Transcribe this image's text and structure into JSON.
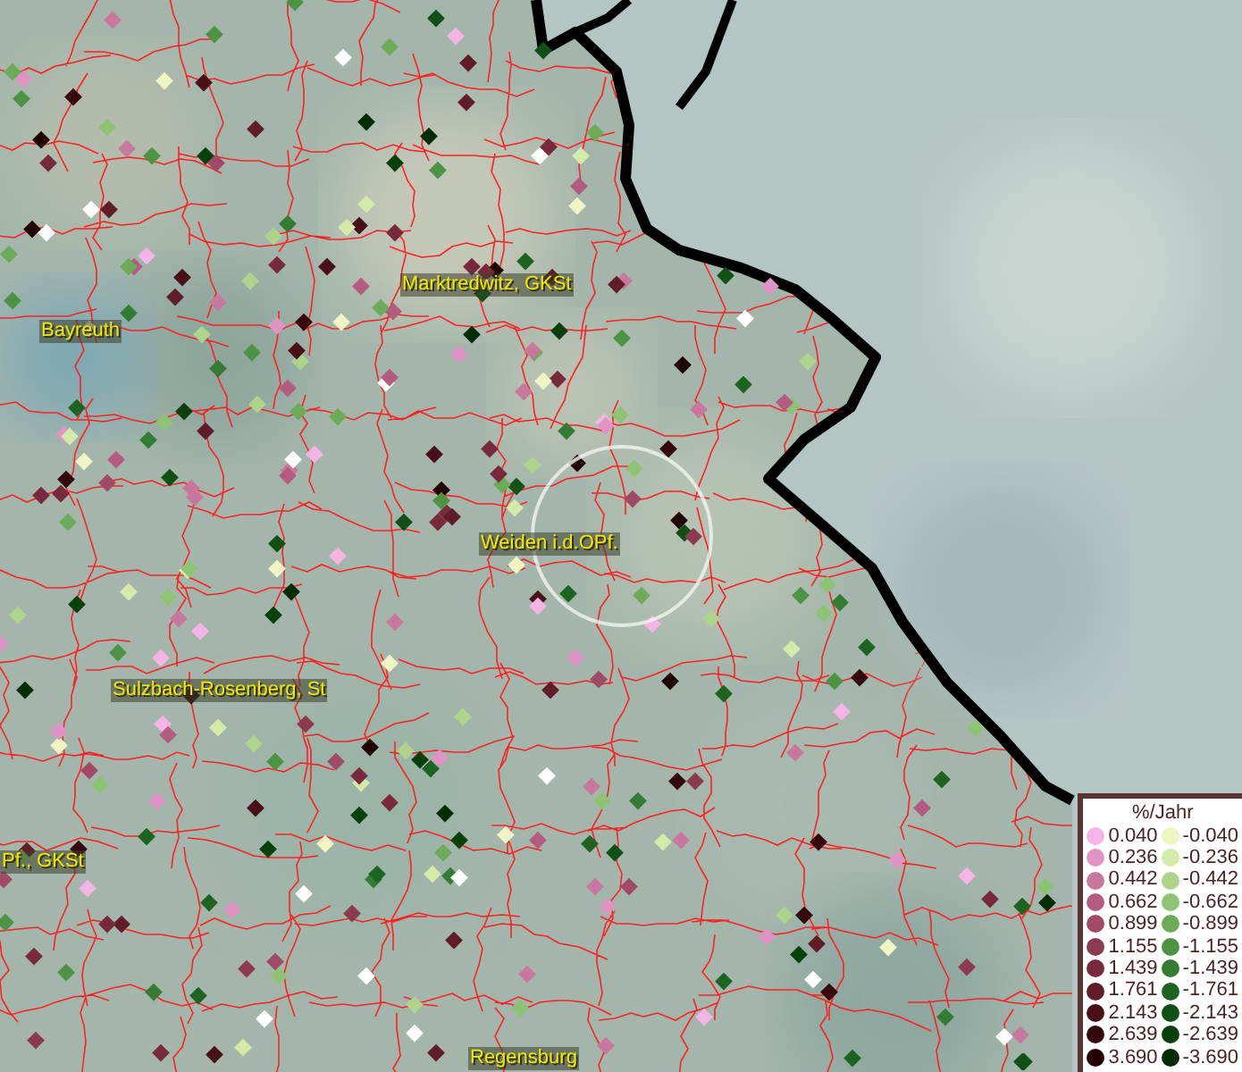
{
  "map": {
    "places": [
      {
        "name": "Marktredwitz, GKSt"
      },
      {
        "name": "Bayreuth"
      },
      {
        "name": "Weiden i.d.OPf."
      },
      {
        "name": "Sulzbach-Rosenberg, St"
      },
      {
        "name": "Pf., GKSt"
      },
      {
        "name": "Regensburg"
      }
    ]
  },
  "legend": {
    "title": "%/Jahr",
    "rows": [
      {
        "positive": {
          "value": "0.040",
          "color": "#f4b4e4"
        },
        "negative": {
          "value": "-0.040",
          "color": "#f0f5c4"
        }
      },
      {
        "positive": {
          "value": "0.236",
          "color": "#e094c4"
        },
        "negative": {
          "value": "-0.236",
          "color": "#d4eaa8"
        }
      },
      {
        "positive": {
          "value": "0.442",
          "color": "#c8789c"
        },
        "negative": {
          "value": "-0.442",
          "color": "#aed48c"
        }
      },
      {
        "positive": {
          "value": "0.662",
          "color": "#b45c80"
        },
        "negative": {
          "value": "-0.662",
          "color": "#8cc474"
        }
      },
      {
        "positive": {
          "value": "0.899",
          "color": "#a04a68"
        },
        "negative": {
          "value": "-0.899",
          "color": "#6cac58"
        }
      },
      {
        "positive": {
          "value": "1.155",
          "color": "#8c3a50"
        },
        "negative": {
          "value": "-1.155",
          "color": "#4c9444"
        }
      },
      {
        "positive": {
          "value": "1.439",
          "color": "#782a3c"
        },
        "negative": {
          "value": "-1.439",
          "color": "#347c34"
        }
      },
      {
        "positive": {
          "value": "1.761",
          "color": "#601c28"
        },
        "negative": {
          "value": "-1.761",
          "color": "#1c6420"
        }
      },
      {
        "positive": {
          "value": "2.143",
          "color": "#481018"
        },
        "negative": {
          "value": "-2.143",
          "color": "#105014"
        }
      },
      {
        "positive": {
          "value": "2.639",
          "color": "#34080c"
        },
        "negative": {
          "value": "-2.639",
          "color": "#08400c"
        }
      },
      {
        "positive": {
          "value": "3.690",
          "color": "#200000"
        },
        "negative": {
          "value": "-3.690",
          "color": "#002c04"
        }
      }
    ]
  }
}
